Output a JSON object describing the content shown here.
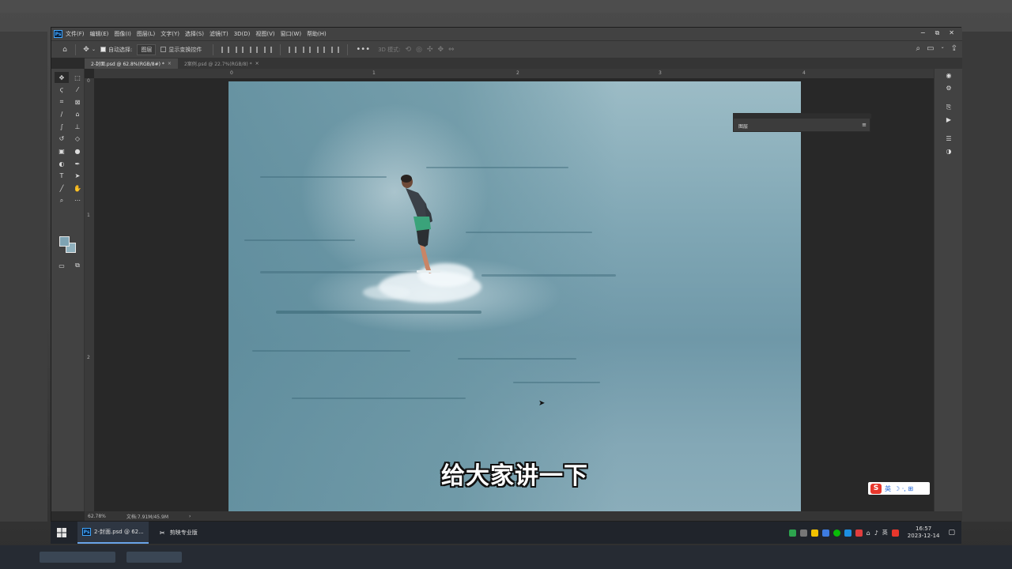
{
  "menubar": {
    "app_badge": "Ps",
    "items": [
      "文件(F)",
      "编辑(E)",
      "图像(I)",
      "图层(L)",
      "文字(Y)",
      "选择(S)",
      "滤镜(T)",
      "3D(D)",
      "视图(V)",
      "窗口(W)",
      "帮助(H)"
    ]
  },
  "options": {
    "auto_select_label": "自动选择:",
    "auto_select_value": "图层",
    "show_transform_label": "显示变换控件",
    "mode_3d_label": "3D 模式:"
  },
  "tabs": [
    {
      "label": "2-封面.psd @ 62.8%(RGB/8#) *",
      "close": "×"
    },
    {
      "label": "2案例.psd @ 22.7%(RGB/8) *",
      "close": "×"
    }
  ],
  "ruler": {
    "top_ticks": [
      "0",
      "1",
      "2",
      "3",
      "4"
    ],
    "left_ticks": [
      "0",
      "1",
      "2"
    ]
  },
  "layers_panel": {
    "title": "图层",
    "menu_icon": "menu-icon"
  },
  "canvas": {
    "subtitle": "给大家讲一下",
    "colors": {
      "artboard": "#86a9b7",
      "sea_dark": "#6f98a8"
    }
  },
  "status": {
    "zoom": "62.78%",
    "doc_info": "文档:7.91M/45.9M",
    "arrow": "›"
  },
  "ime": {
    "logo": "S",
    "lang": "英",
    "extra": "☽ ·, ⊞"
  },
  "taskbar": {
    "apps": [
      {
        "icon": "Ps",
        "label": "2-封面.psd @ 62..."
      },
      {
        "icon": "✂",
        "label": "剪映专业版"
      }
    ],
    "tray_lang": "英",
    "time": "16:57",
    "date": "2023-12-14"
  }
}
